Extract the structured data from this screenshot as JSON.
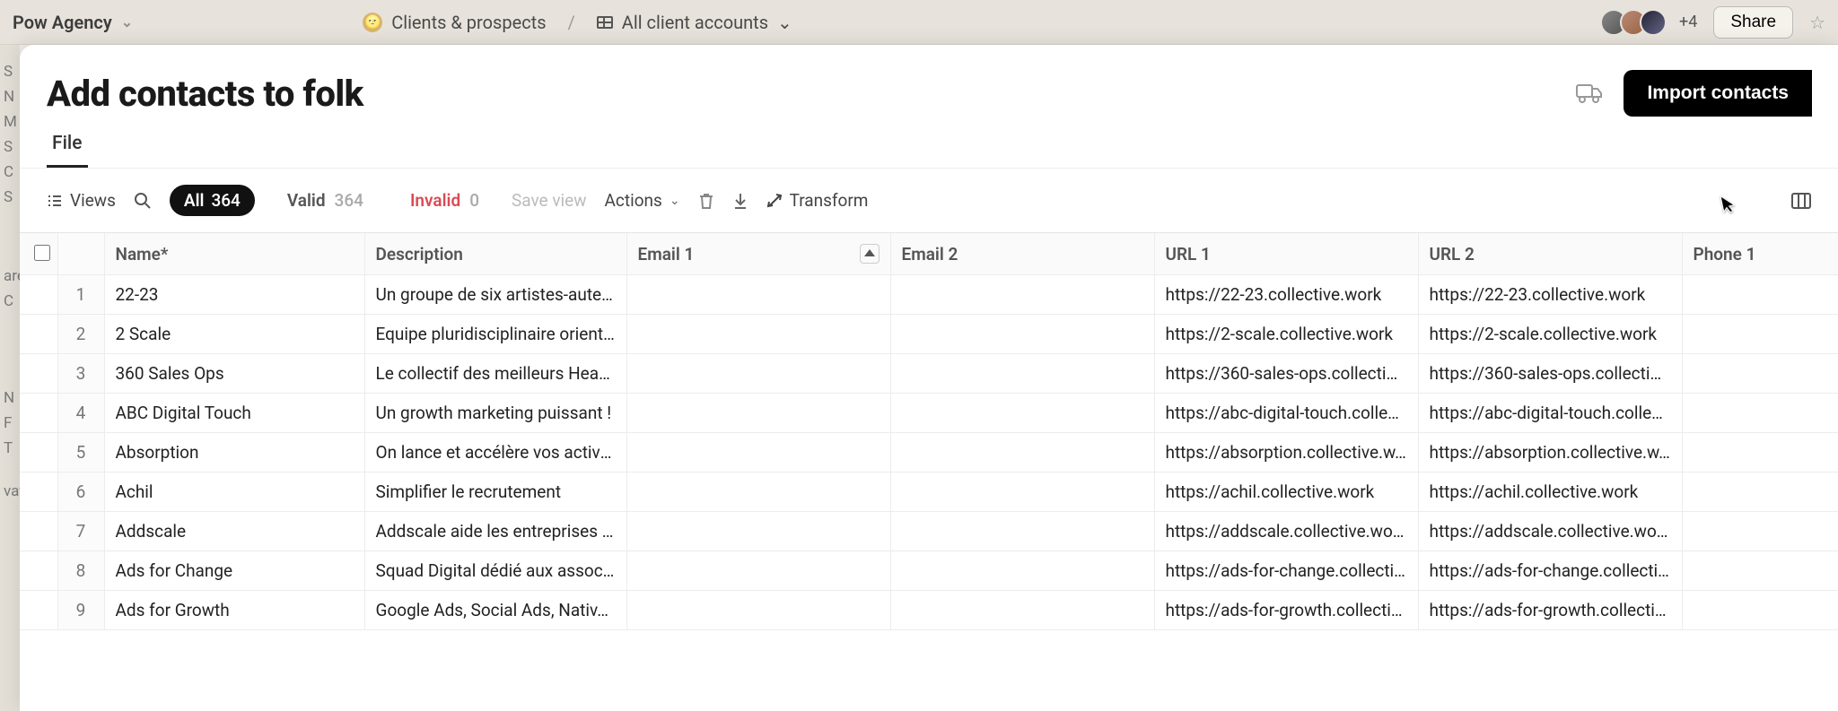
{
  "header": {
    "workspace": "Pow Agency",
    "breadcrumb1": "Clients & prospects",
    "breadcrumb2": "All client accounts",
    "more_avatars": "+4",
    "share": "Share"
  },
  "modal": {
    "title": "Add contacts to folk",
    "import_btn": "Import contacts",
    "tab_file": "File"
  },
  "toolbar": {
    "views": "Views",
    "all_label": "All",
    "all_count": "364",
    "valid_label": "Valid",
    "valid_count": "364",
    "invalid_label": "Invalid",
    "invalid_count": "0",
    "save_view": "Save view",
    "actions": "Actions",
    "transform": "Transform"
  },
  "columns": {
    "name": "Name*",
    "description": "Description",
    "email1": "Email 1",
    "email2": "Email 2",
    "url1": "URL 1",
    "url2": "URL 2",
    "phone1": "Phone 1"
  },
  "rows": [
    {
      "n": "1",
      "name": "22-23",
      "desc": "Un groupe de six artistes-aute…",
      "e1": "",
      "e2": "",
      "u1": "https://22-23.collective.work",
      "u2": "https://22-23.collective.work",
      "p1": ""
    },
    {
      "n": "2",
      "name": "2 Scale",
      "desc": "Equipe pluridisciplinaire orient…",
      "e1": "",
      "e2": "",
      "u1": "https://2-scale.collective.work",
      "u2": "https://2-scale.collective.work",
      "p1": ""
    },
    {
      "n": "3",
      "name": "360 Sales Ops",
      "desc": "Le collectif des meilleurs Head…",
      "e1": "",
      "e2": "",
      "u1": "https://360-sales-ops.collecti…",
      "u2": "https://360-sales-ops.collecti…",
      "p1": ""
    },
    {
      "n": "4",
      "name": "ABC Digital Touch",
      "desc": "Un growth marketing puissant !",
      "e1": "",
      "e2": "",
      "u1": "https://abc-digital-touch.colle…",
      "u2": "https://abc-digital-touch.colle…",
      "p1": ""
    },
    {
      "n": "5",
      "name": "Absorption",
      "desc": "On lance et accélère vos activi…",
      "e1": "",
      "e2": "",
      "u1": "https://absorption.collective.w…",
      "u2": "https://absorption.collective.w…",
      "p1": ""
    },
    {
      "n": "6",
      "name": "Achil",
      "desc": "Simplifier le recrutement",
      "e1": "",
      "e2": "",
      "u1": "https://achil.collective.work",
      "u2": "https://achil.collective.work",
      "p1": ""
    },
    {
      "n": "7",
      "name": "Addscale",
      "desc": "Addscale aide les entreprises …",
      "e1": "",
      "e2": "",
      "u1": "https://addscale.collective.work",
      "u2": "https://addscale.collective.work",
      "p1": ""
    },
    {
      "n": "8",
      "name": "Ads for Change",
      "desc": "Squad Digital dédié aux associ…",
      "e1": "",
      "e2": "",
      "u1": "https://ads-for-change.collecti…",
      "u2": "https://ads-for-change.collecti…",
      "p1": ""
    },
    {
      "n": "9",
      "name": "Ads for Growth",
      "desc": "Google Ads, Social Ads, Nativ…",
      "e1": "",
      "e2": "",
      "u1": "https://ads-for-growth.collecti…",
      "u2": "https://ads-for-growth.collecti…",
      "p1": ""
    }
  ]
}
